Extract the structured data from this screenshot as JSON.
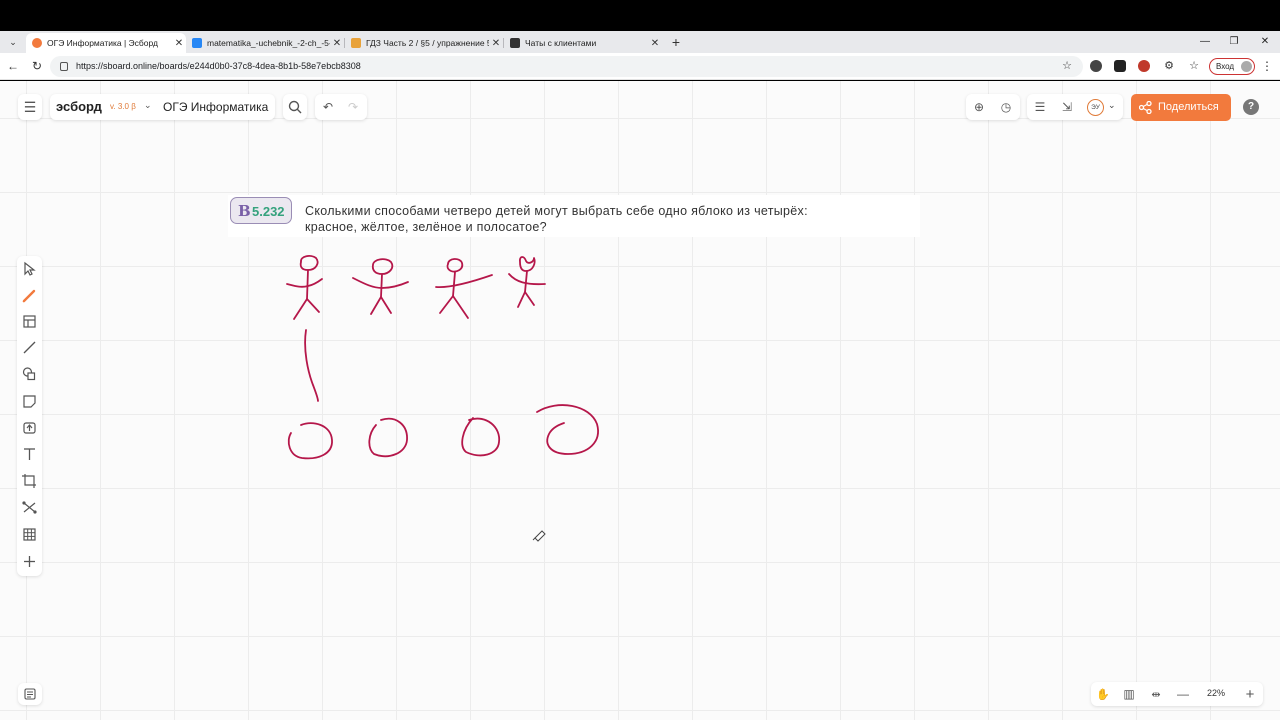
{
  "browser": {
    "tabs": [
      {
        "title": "ОГЭ Информатика | Эсборд",
        "active": true,
        "favicon_color": "#f27a3d"
      },
      {
        "title": "matematika_-uchebnik_-2-ch_-5-...",
        "active": false,
        "favicon_color": "#2787f5"
      },
      {
        "title": "ГДЗ Часть 2 / §5 / упражнение 5...",
        "active": false,
        "favicon_color": "#e8a23a"
      },
      {
        "title": "Чаты с клиентами",
        "active": false,
        "favicon_color": "#333333"
      }
    ],
    "url": "https://sboard.online/boards/e244d0b0-37c8-4dea-8b1b-58e7ebcb8308",
    "login_label": "Вход"
  },
  "app": {
    "logo": "эсборд",
    "version": "v. 3.0 β",
    "board_name": "ОГЭ Информатика",
    "share_label": "Поделиться",
    "help_label": "?",
    "user_initials": "ЭУ",
    "accent_color": "#f27a3d",
    "ink_color": "#b5174a"
  },
  "problem": {
    "badge_letter": "В",
    "number": "5.232",
    "line1": "Сколькими способами четверо детей могут выбрать себе одно яблоко из четырёх:",
    "line2": "красное, жёлтое, зелёное и полосатое?"
  },
  "tools": [
    "cursor-icon",
    "pen-icon",
    "frame-icon",
    "line-icon",
    "shapes-icon",
    "sticky-note-icon",
    "upload-icon",
    "text-icon",
    "crop-icon",
    "connector-icon",
    "table-icon",
    "plus-icon"
  ],
  "zoom": "22%"
}
